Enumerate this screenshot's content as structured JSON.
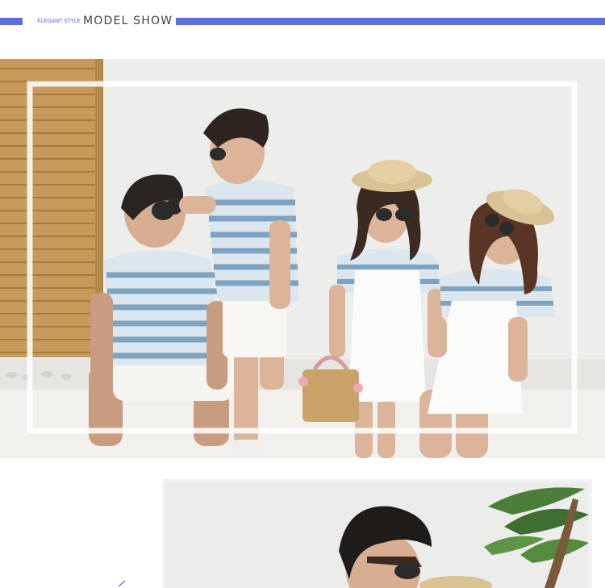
{
  "section": {
    "label": "MODEL SHOW",
    "script": "ELEGANT STYLE",
    "accent": "#5b6fe0"
  },
  "photos": [
    {
      "name": "family-model-photo",
      "icon": "photo-image"
    },
    {
      "name": "father-closeup-photo",
      "icon": "photo-image"
    }
  ]
}
